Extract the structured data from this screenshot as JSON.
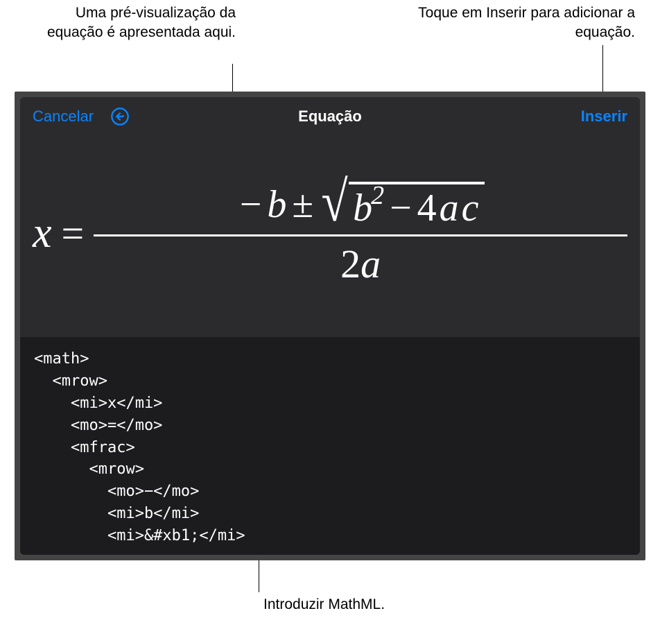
{
  "callouts": {
    "preview": "Uma pré-visualização da equação é apresentada aqui.",
    "insert": "Toque em Inserir para adicionar a equação.",
    "mathml": "Introduzir MathML."
  },
  "toolbar": {
    "cancel": "Cancelar",
    "title": "Equação",
    "insert": "Inserir"
  },
  "equation": {
    "x": "x",
    "equals": "=",
    "minus": "−",
    "b": "b",
    "plusminus": "±",
    "sqrt_b": "b",
    "sqrt_exp": "2",
    "sqrt_minus": "−",
    "four": "4",
    "a": "a",
    "c": "c",
    "denom_two": "2",
    "denom_a": "a"
  },
  "code": {
    "line1": "<math>",
    "line2": "  <mrow>",
    "line3": "    <mi>x</mi>",
    "line4": "    <mo>=</mo>",
    "line5": "    <mfrac>",
    "line6": "      <mrow>",
    "line7": "        <mo>−</mo>",
    "line8": "        <mi>b</mi>",
    "line9": "        <mi>&#xb1;</mi>"
  }
}
